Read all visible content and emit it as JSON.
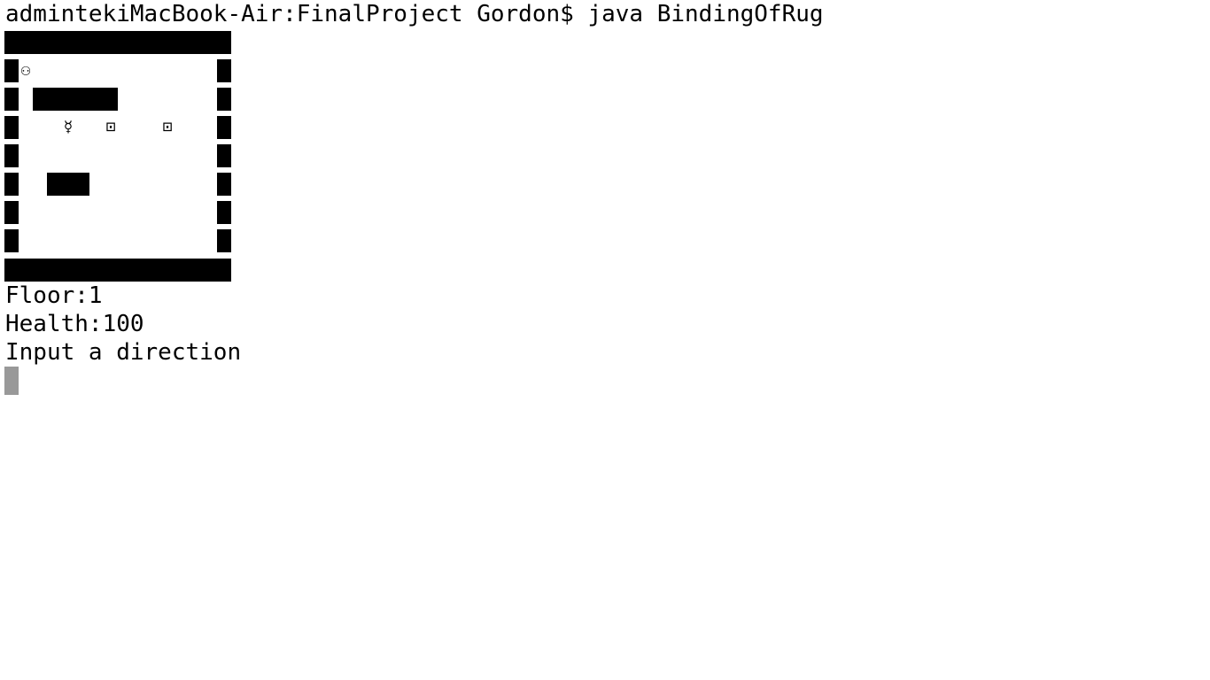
{
  "terminal": {
    "prompt_line": "adminteki MacBook-Air:FinalProject Gordon$ java BindingOfRug",
    "prompt_line_exact": "adminteki​MacBook-Air:FinalProject Gordon$ java BindingOfRug",
    "floor_text": "Floor:1",
    "health_text": "Health:100",
    "instruction_text": "Input a direction",
    "cursor_color": "#999999"
  },
  "game_map": {
    "player_glyph": "⚇",
    "item_glyph": "☿",
    "box_glyph_1": "⊡",
    "box_glyph_2": "⊡",
    "wall_color": "#000000"
  }
}
